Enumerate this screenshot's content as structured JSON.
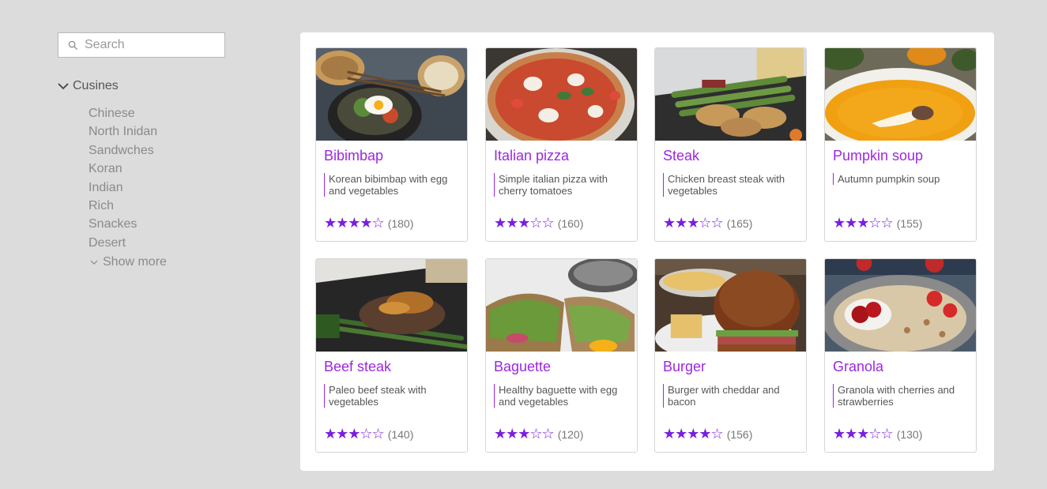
{
  "search": {
    "placeholder": "Search"
  },
  "sidebar": {
    "header": "Cusines",
    "items": [
      "Chinese",
      "North Inidan",
      "Sandwches",
      "Koran",
      "Indian",
      "Rich",
      "Snackes",
      "Desert"
    ],
    "show_more": "Show more"
  },
  "accent_color": "#9c27e0",
  "star_color": "#7a1fe0",
  "cards": [
    {
      "title": "Bibimbap",
      "description": "Korean bibimbap with egg and vegetables",
      "stars": "★★★★☆",
      "rating": 4,
      "count": "(180)"
    },
    {
      "title": "Italian pizza",
      "description": "Simple italian pizza with cherry tomatoes",
      "stars": "★★★☆☆",
      "rating": 3,
      "count": "(160)"
    },
    {
      "title": "Steak",
      "description": "Chicken breast steak with vegetables",
      "stars": "★★★☆☆",
      "rating": 3,
      "count": "(165)"
    },
    {
      "title": "Pumpkin soup",
      "description": "Autumn pumpkin soup",
      "stars": "★★★☆☆",
      "rating": 3,
      "count": "(155)"
    },
    {
      "title": "Beef steak",
      "description": "Paleo beef steak with vegetables",
      "stars": "★★★☆☆",
      "rating": 3,
      "count": "(140)"
    },
    {
      "title": "Baguette",
      "description": "Healthy baguette with egg and vegetables",
      "stars": "★★★☆☆",
      "rating": 3,
      "count": "(120)"
    },
    {
      "title": "Burger",
      "description": "Burger with cheddar and bacon",
      "stars": "★★★★☆",
      "rating": 4,
      "count": "(156)"
    },
    {
      "title": "Granola",
      "description": "Granola with cherries and strawberries",
      "stars": "★★★☆☆",
      "rating": 3,
      "count": "(130)"
    }
  ]
}
